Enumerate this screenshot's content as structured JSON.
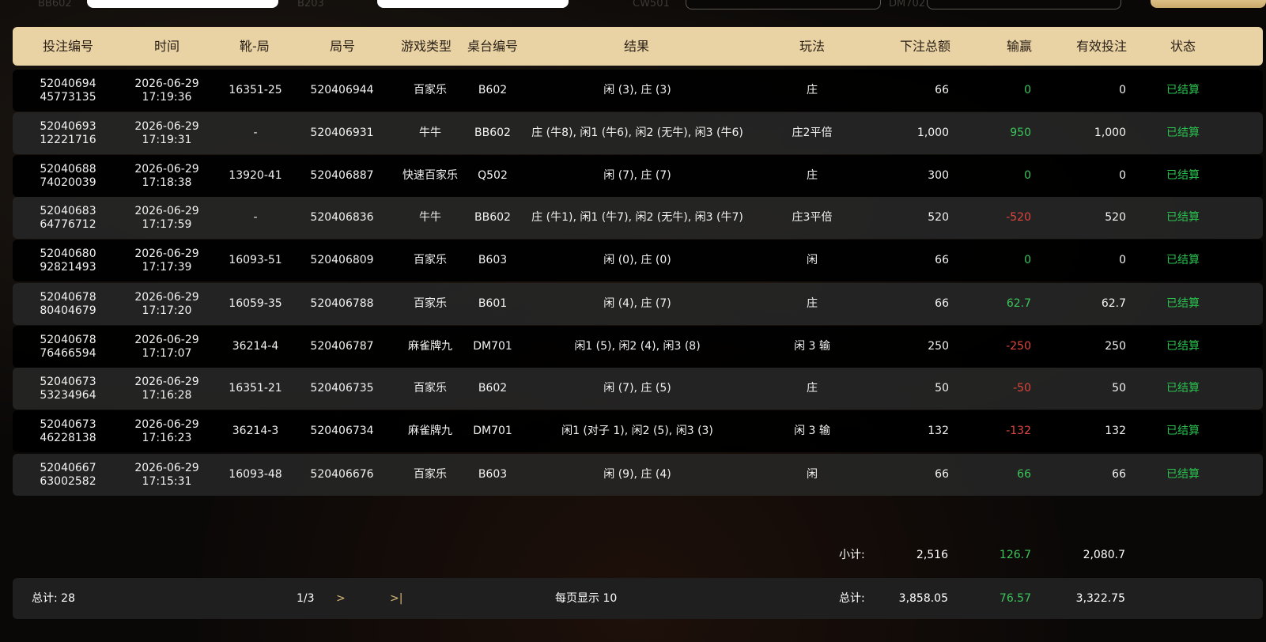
{
  "top_filters": {
    "label1": "BB602",
    "label2": "B203",
    "label3": "CW501",
    "label4": "DM702"
  },
  "table": {
    "headers": [
      "投注编号",
      "时间",
      "靴-局",
      "局号",
      "游戏类型",
      "桌台编号",
      "结果",
      "玩法",
      "下注总额",
      "输赢",
      "有效投注",
      "状态"
    ],
    "rows": [
      {
        "bet_id_1": "52040694",
        "bet_id_2": "45773135",
        "date": "2026-06-29",
        "time": "17:19:36",
        "shoe": "16351-25",
        "round": "520406944",
        "game": "百家乐",
        "table": "B602",
        "result": "闲 (3), 庄 (3)",
        "play": "庄",
        "amount": "66",
        "winloss": "0",
        "winloss_type": "pos",
        "valid": "0",
        "status": "已结算"
      },
      {
        "bet_id_1": "52040693",
        "bet_id_2": "12221716",
        "date": "2026-06-29",
        "time": "17:19:31",
        "shoe": "-",
        "round": "520406931",
        "game": "牛牛",
        "table": "BB602",
        "result": "庄 (牛8), 闲1 (牛6), 闲2 (无牛), 闲3 (牛6)",
        "play": "庄2平倍",
        "amount": "1,000",
        "winloss": "950",
        "winloss_type": "pos",
        "valid": "1,000",
        "status": "已结算"
      },
      {
        "bet_id_1": "52040688",
        "bet_id_2": "74020039",
        "date": "2026-06-29",
        "time": "17:18:38",
        "shoe": "13920-41",
        "round": "520406887",
        "game": "快速百家乐",
        "table": "Q502",
        "result": "闲 (7), 庄 (7)",
        "play": "庄",
        "amount": "300",
        "winloss": "0",
        "winloss_type": "pos",
        "valid": "0",
        "status": "已结算"
      },
      {
        "bet_id_1": "52040683",
        "bet_id_2": "64776712",
        "date": "2026-06-29",
        "time": "17:17:59",
        "shoe": "-",
        "round": "520406836",
        "game": "牛牛",
        "table": "BB602",
        "result": "庄 (牛1), 闲1 (牛7), 闲2 (无牛), 闲3 (牛7)",
        "play": "庄3平倍",
        "amount": "520",
        "winloss": "-520",
        "winloss_type": "neg",
        "valid": "520",
        "status": "已结算"
      },
      {
        "bet_id_1": "52040680",
        "bet_id_2": "92821493",
        "date": "2026-06-29",
        "time": "17:17:39",
        "shoe": "16093-51",
        "round": "520406809",
        "game": "百家乐",
        "table": "B603",
        "result": "闲 (0), 庄 (0)",
        "play": "闲",
        "amount": "66",
        "winloss": "0",
        "winloss_type": "pos",
        "valid": "0",
        "status": "已结算"
      },
      {
        "bet_id_1": "52040678",
        "bet_id_2": "80404679",
        "date": "2026-06-29",
        "time": "17:17:20",
        "shoe": "16059-35",
        "round": "520406788",
        "game": "百家乐",
        "table": "B601",
        "result": "闲 (4), 庄 (7)",
        "play": "庄",
        "amount": "66",
        "winloss": "62.7",
        "winloss_type": "pos",
        "valid": "62.7",
        "status": "已结算"
      },
      {
        "bet_id_1": "52040678",
        "bet_id_2": "76466594",
        "date": "2026-06-29",
        "time": "17:17:07",
        "shoe": "36214-4",
        "round": "520406787",
        "game": "麻雀牌九",
        "table": "DM701",
        "result": "闲1 (5), 闲2 (4), 闲3 (8)",
        "play": "闲 3 输",
        "amount": "250",
        "winloss": "-250",
        "winloss_type": "neg",
        "valid": "250",
        "status": "已结算"
      },
      {
        "bet_id_1": "52040673",
        "bet_id_2": "53234964",
        "date": "2026-06-29",
        "time": "17:16:28",
        "shoe": "16351-21",
        "round": "520406735",
        "game": "百家乐",
        "table": "B602",
        "result": "闲 (7), 庄 (5)",
        "play": "庄",
        "amount": "50",
        "winloss": "-50",
        "winloss_type": "neg",
        "valid": "50",
        "status": "已结算"
      },
      {
        "bet_id_1": "52040673",
        "bet_id_2": "46228138",
        "date": "2026-06-29",
        "time": "17:16:23",
        "shoe": "36214-3",
        "round": "520406734",
        "game": "麻雀牌九",
        "table": "DM701",
        "result": "闲1 (对子 1), 闲2 (5), 闲3 (3)",
        "play": "闲 3 输",
        "amount": "132",
        "winloss": "-132",
        "winloss_type": "neg",
        "valid": "132",
        "status": "已结算"
      },
      {
        "bet_id_1": "52040667",
        "bet_id_2": "63002582",
        "date": "2026-06-29",
        "time": "17:15:31",
        "shoe": "16093-48",
        "round": "520406676",
        "game": "百家乐",
        "table": "B603",
        "result": "闲 (9), 庄 (4)",
        "play": "闲",
        "amount": "66",
        "winloss": "66",
        "winloss_type": "pos",
        "valid": "66",
        "status": "已结算"
      }
    ]
  },
  "subtotal": {
    "label": "小计:",
    "amount": "2,516",
    "winloss": "126.7",
    "valid": "2,080.7"
  },
  "footer": {
    "count_label": "总计: 28",
    "page": "1/3",
    "next": ">",
    "last": ">|",
    "per_page": "每页显示 10",
    "total_label": "总计:",
    "amount": "3,858.05",
    "winloss": "76.57",
    "valid": "3,322.75"
  },
  "colors": {
    "header_bg": "#e9d2a3",
    "positive": "#3bc55a",
    "negative": "#e0453f",
    "status": "#28c24e"
  }
}
